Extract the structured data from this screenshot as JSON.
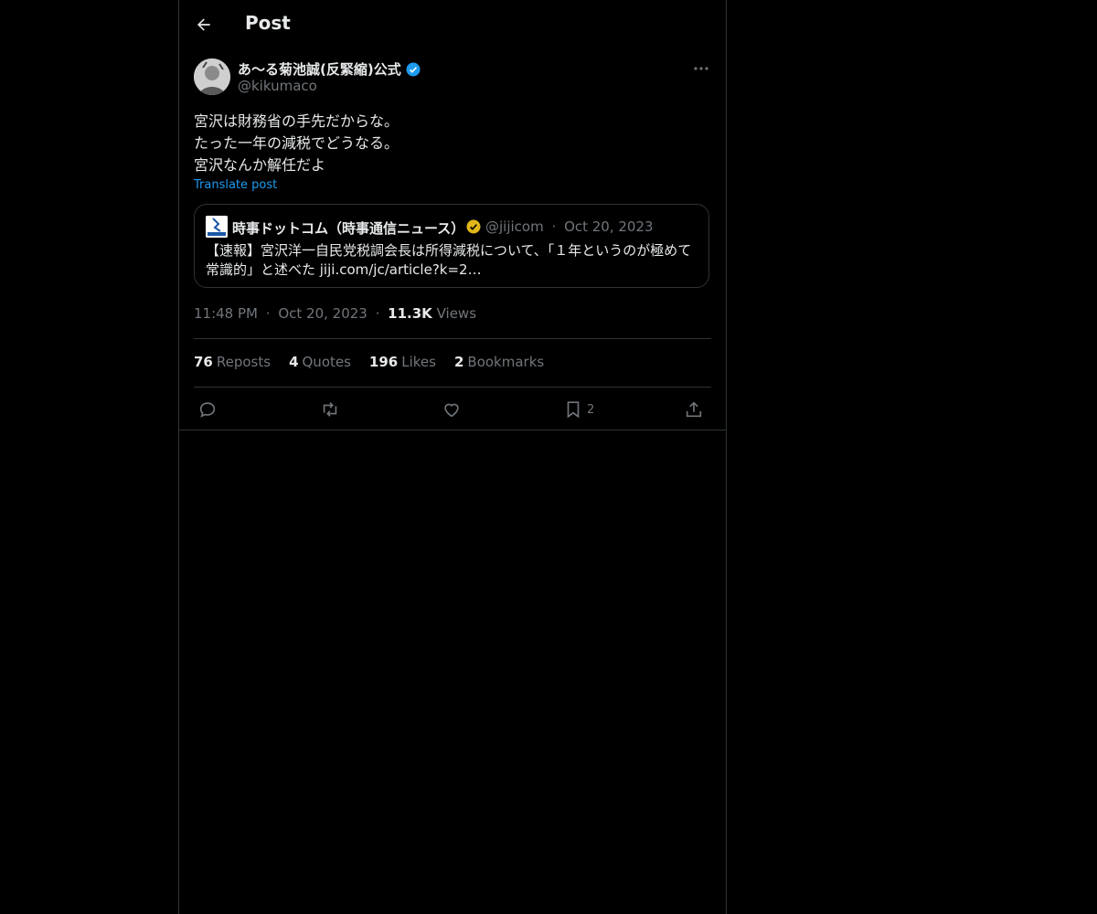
{
  "header": {
    "title": "Post"
  },
  "author": {
    "name": "あ〜る菊池誠(反緊縮)公式",
    "handle": "@kikumaco"
  },
  "post": {
    "text": "宮沢は財務省の手先だからな。\nたった一年の減税でどうなる。\n宮沢なんか解任だよ",
    "translate_label": "Translate post"
  },
  "quote": {
    "name": "時事ドットコム（時事通信ニュース）",
    "handle": "@jijicom",
    "separator": "·",
    "date": "Oct 20, 2023",
    "text": "【速報】宮沢洋一自民党税調会長は所得減税について、「１年というのが極めて常識的」と述べた jiji.com/jc/article?k=2…"
  },
  "meta": {
    "time": "11:48 PM",
    "separator": "·",
    "date": "Oct 20, 2023",
    "views_value": "11.3K",
    "views_label": "Views"
  },
  "stats": [
    {
      "value": "76",
      "label": "Reposts"
    },
    {
      "value": "4",
      "label": "Quotes"
    },
    {
      "value": "196",
      "label": "Likes"
    },
    {
      "value": "2",
      "label": "Bookmarks"
    }
  ],
  "actions": {
    "reply": {
      "icon": "reply-icon"
    },
    "repost": {
      "icon": "repost-icon"
    },
    "like": {
      "icon": "heart-icon"
    },
    "bookmark": {
      "icon": "bookmark-icon",
      "count": "2"
    },
    "share": {
      "icon": "share-icon"
    }
  },
  "colors": {
    "background": "#000000",
    "text": "#e7e9ea",
    "muted": "#71767b",
    "link": "#1d9bf0",
    "border": "#2f3336",
    "gold_badge": "#e2b719"
  }
}
